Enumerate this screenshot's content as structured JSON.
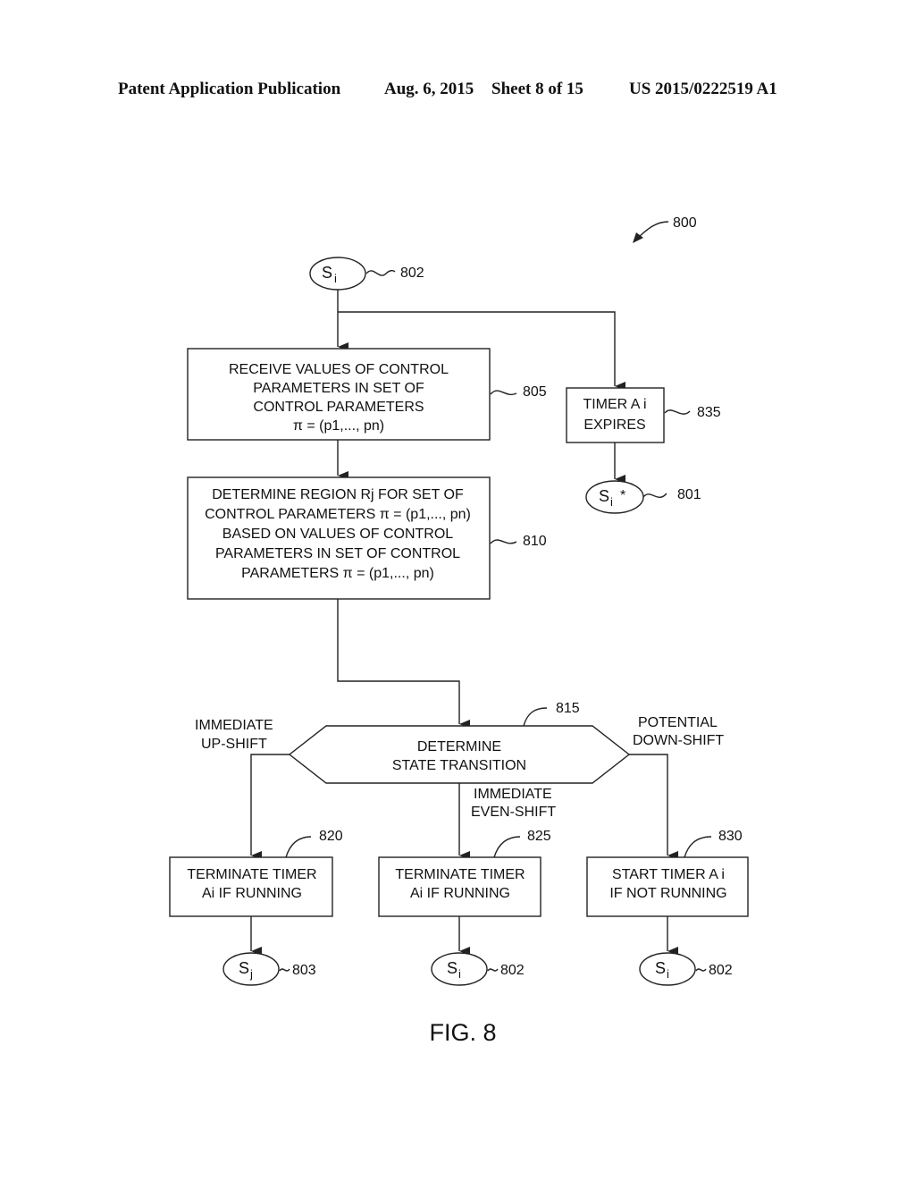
{
  "header": {
    "publication": "Patent Application Publication",
    "date": "Aug. 6, 2015",
    "sheet": "Sheet 8 of 15",
    "number": "US 2015/0222519 A1"
  },
  "figure": {
    "label": "FIG. 8",
    "ref": "800"
  },
  "nodes": {
    "start": {
      "state": "S",
      "sub": "i",
      "ref": "802"
    },
    "box805": {
      "ref": "805",
      "lines": [
        "RECEIVE VALUES OF CONTROL",
        "PARAMETERS IN SET OF",
        "CONTROL PARAMETERS",
        "π = (p1,..., pn)"
      ]
    },
    "box810": {
      "ref": "810",
      "lines": [
        "DETERMINE REGION Rj FOR SET OF",
        "CONTROL PARAMETERS π = (p1,..., pn)",
        "BASED ON VALUES OF CONTROL",
        "PARAMETERS IN SET OF CONTROL",
        "PARAMETERS π = (p1,..., pn)"
      ]
    },
    "box835": {
      "ref": "835",
      "lines": [
        "TIMER A i",
        "EXPIRES"
      ]
    },
    "end801": {
      "state": "S",
      "sub": "i",
      "suffix": "*",
      "ref": "801"
    },
    "decision815": {
      "ref": "815",
      "lines": [
        "DETERMINE",
        "STATE TRANSITION"
      ]
    },
    "branches": {
      "left": [
        "IMMEDIATE",
        "UP-SHIFT"
      ],
      "middle": [
        "IMMEDIATE",
        "EVEN-SHIFT"
      ],
      "right": [
        "POTENTIAL",
        "DOWN-SHIFT"
      ]
    },
    "box820": {
      "ref": "820",
      "lines": [
        "TERMINATE TIMER",
        "Ai IF RUNNING"
      ]
    },
    "box825": {
      "ref": "825",
      "lines": [
        "TERMINATE TIMER",
        "Ai IF RUNNING"
      ]
    },
    "box830": {
      "ref": "830",
      "lines": [
        "START TIMER A i",
        "IF NOT RUNNING"
      ]
    },
    "end803": {
      "state": "S",
      "sub": "j",
      "ref": "803"
    },
    "end802a": {
      "state": "S",
      "sub": "i",
      "ref": "802"
    },
    "end802b": {
      "state": "S",
      "sub": "i",
      "ref": "802"
    }
  }
}
